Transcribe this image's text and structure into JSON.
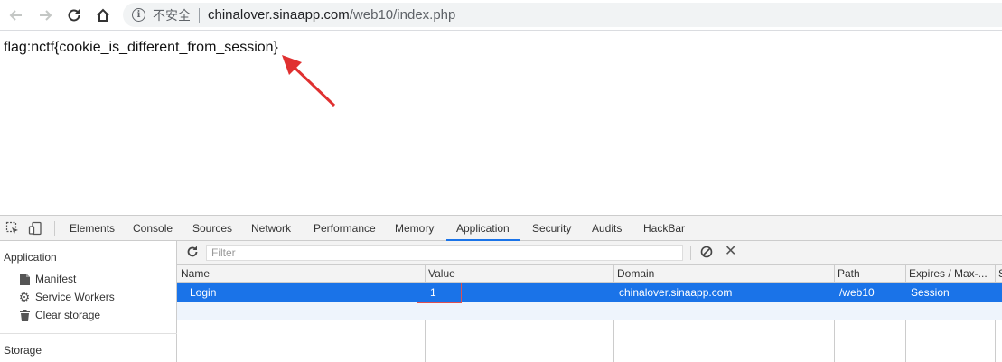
{
  "browser": {
    "insecure_label": "不安全",
    "url_host": "chinalover.sinaapp.com",
    "url_path": "/web10/index.php"
  },
  "page": {
    "flag_text": "flag:nctf{cookie_is_different_from_session}"
  },
  "devtools": {
    "tabs": [
      "Elements",
      "Console",
      "Sources",
      "Network",
      "Performance",
      "Memory",
      "Application",
      "Security",
      "Audits",
      "HackBar"
    ],
    "active_tab": "Application",
    "sidebar": {
      "application_heading": "Application",
      "items": [
        "Manifest",
        "Service Workers",
        "Clear storage"
      ],
      "storage_heading": "Storage"
    },
    "filter_placeholder": "Filter",
    "columns": [
      "Name",
      "Value",
      "Domain",
      "Path",
      "Expires / Max-...",
      "S"
    ],
    "rows": [
      {
        "name": "Login",
        "value": "1",
        "domain": "chinalover.sinaapp.com",
        "path": "/web10",
        "expires": "Session"
      }
    ]
  },
  "colors": {
    "selection": "#1a73e8",
    "annotation": "#e03030"
  }
}
